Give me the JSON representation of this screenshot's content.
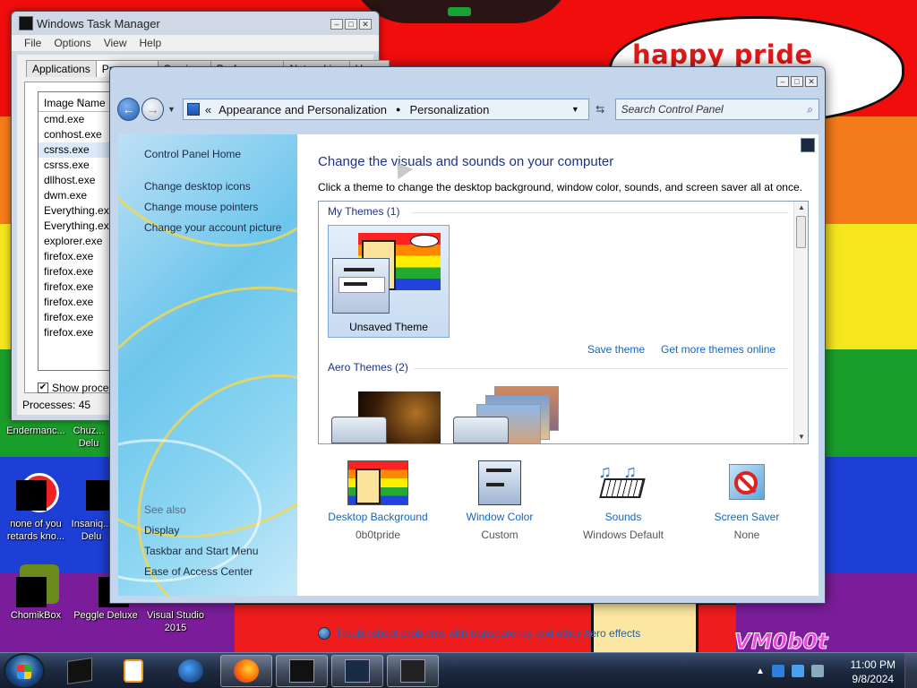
{
  "wallpaper": {
    "speech_text": "happy pride month",
    "watermark": "VM0b0t",
    "stripe_colors": [
      "#f20d0d",
      "#f47b1a",
      "#f5e61d",
      "#1a9e2b",
      "#1d3fd6",
      "#7b1d9a"
    ]
  },
  "desktop_icons": [
    {
      "label": "Endermanc...",
      "icon": "app-icon"
    },
    {
      "label": "Chuz... Delu",
      "icon": "app-icon"
    },
    {
      "label": "none of you retards kno...",
      "icon": "app-icon"
    },
    {
      "label": "Insaniq... Delu",
      "icon": "app-icon"
    },
    {
      "label": "ChomikBox",
      "icon": "chomikbox-icon"
    },
    {
      "label": "Peggle Deluxe",
      "icon": "peggle-icon"
    },
    {
      "label": "Visual Studio 2015",
      "icon": "visual-studio-icon"
    }
  ],
  "taskmgr": {
    "title": "Windows Task Manager",
    "menu": [
      "File",
      "Options",
      "View",
      "Help"
    ],
    "tabs": [
      "Applications",
      "Processes",
      "Services",
      "Performance",
      "Networking",
      "Users"
    ],
    "active_tab": "Processes",
    "column_header": "Image Name",
    "processes": [
      "cmd.exe",
      "conhost.exe",
      "csrss.exe",
      "csrss.exe",
      "dllhost.exe",
      "dwm.exe",
      "Everything.exe",
      "Everything.exe",
      "explorer.exe",
      "firefox.exe",
      "firefox.exe",
      "firefox.exe",
      "firefox.exe",
      "firefox.exe",
      "firefox.exe"
    ],
    "selected_index": 2,
    "show_processes_label": "Show process",
    "show_processes_checked": true,
    "status": "Processes: 45"
  },
  "cp": {
    "breadcrumb": [
      "Appearance and Personalization",
      "Personalization"
    ],
    "breadcrumb_prefix": "«",
    "search_placeholder": "Search Control Panel",
    "left_links": [
      "Control Panel Home",
      "Change desktop icons",
      "Change mouse pointers",
      "Change your account picture"
    ],
    "see_also_label": "See also",
    "see_also_links": [
      "Display",
      "Taskbar and Start Menu",
      "Ease of Access Center"
    ],
    "heading": "Change the visuals and sounds on your computer",
    "subheading": "Click a theme to change the desktop background, window color, sounds, and screen saver all at once.",
    "my_themes_header": "My Themes (1)",
    "unsaved_theme": "Unsaved Theme",
    "save_theme": "Save theme",
    "get_more_themes": "Get more themes online",
    "aero_themes_header": "Aero Themes (2)",
    "bottom": [
      {
        "label": "Desktop Background",
        "value": "0b0tpride",
        "icon": "desktop-background-icon"
      },
      {
        "label": "Window Color",
        "value": "Custom",
        "icon": "window-color-icon"
      },
      {
        "label": "Sounds",
        "value": "Windows Default",
        "icon": "sounds-icon"
      },
      {
        "label": "Screen Saver",
        "value": "None",
        "icon": "screen-saver-icon"
      }
    ],
    "troubleshoot": "Troubleshoot problems with transparency and other Aero effects"
  },
  "taskbar": {
    "time": "11:00 PM",
    "date": "9/8/2024",
    "pinned": [
      "terminal-icon",
      "media-player-icon",
      "globe-icon",
      "firefox-icon",
      "window-icon-1",
      "window-icon-2",
      "window-icon-3"
    ]
  }
}
